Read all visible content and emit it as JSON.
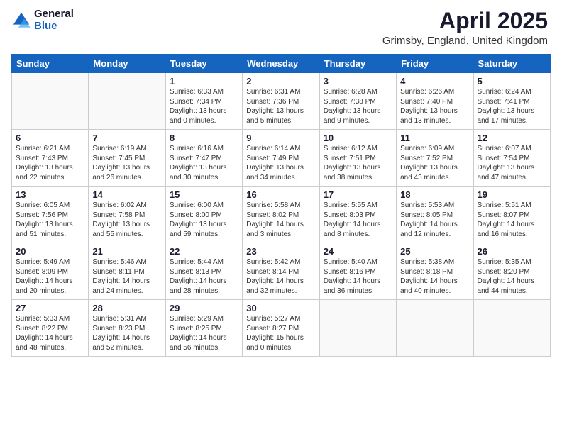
{
  "header": {
    "logo_general": "General",
    "logo_blue": "Blue",
    "month": "April 2025",
    "location": "Grimsby, England, United Kingdom"
  },
  "weekdays": [
    "Sunday",
    "Monday",
    "Tuesday",
    "Wednesday",
    "Thursday",
    "Friday",
    "Saturday"
  ],
  "weeks": [
    [
      {
        "day": "",
        "info": ""
      },
      {
        "day": "",
        "info": ""
      },
      {
        "day": "1",
        "info": "Sunrise: 6:33 AM\nSunset: 7:34 PM\nDaylight: 13 hours and 0 minutes."
      },
      {
        "day": "2",
        "info": "Sunrise: 6:31 AM\nSunset: 7:36 PM\nDaylight: 13 hours and 5 minutes."
      },
      {
        "day": "3",
        "info": "Sunrise: 6:28 AM\nSunset: 7:38 PM\nDaylight: 13 hours and 9 minutes."
      },
      {
        "day": "4",
        "info": "Sunrise: 6:26 AM\nSunset: 7:40 PM\nDaylight: 13 hours and 13 minutes."
      },
      {
        "day": "5",
        "info": "Sunrise: 6:24 AM\nSunset: 7:41 PM\nDaylight: 13 hours and 17 minutes."
      }
    ],
    [
      {
        "day": "6",
        "info": "Sunrise: 6:21 AM\nSunset: 7:43 PM\nDaylight: 13 hours and 22 minutes."
      },
      {
        "day": "7",
        "info": "Sunrise: 6:19 AM\nSunset: 7:45 PM\nDaylight: 13 hours and 26 minutes."
      },
      {
        "day": "8",
        "info": "Sunrise: 6:16 AM\nSunset: 7:47 PM\nDaylight: 13 hours and 30 minutes."
      },
      {
        "day": "9",
        "info": "Sunrise: 6:14 AM\nSunset: 7:49 PM\nDaylight: 13 hours and 34 minutes."
      },
      {
        "day": "10",
        "info": "Sunrise: 6:12 AM\nSunset: 7:51 PM\nDaylight: 13 hours and 38 minutes."
      },
      {
        "day": "11",
        "info": "Sunrise: 6:09 AM\nSunset: 7:52 PM\nDaylight: 13 hours and 43 minutes."
      },
      {
        "day": "12",
        "info": "Sunrise: 6:07 AM\nSunset: 7:54 PM\nDaylight: 13 hours and 47 minutes."
      }
    ],
    [
      {
        "day": "13",
        "info": "Sunrise: 6:05 AM\nSunset: 7:56 PM\nDaylight: 13 hours and 51 minutes."
      },
      {
        "day": "14",
        "info": "Sunrise: 6:02 AM\nSunset: 7:58 PM\nDaylight: 13 hours and 55 minutes."
      },
      {
        "day": "15",
        "info": "Sunrise: 6:00 AM\nSunset: 8:00 PM\nDaylight: 13 hours and 59 minutes."
      },
      {
        "day": "16",
        "info": "Sunrise: 5:58 AM\nSunset: 8:02 PM\nDaylight: 14 hours and 3 minutes."
      },
      {
        "day": "17",
        "info": "Sunrise: 5:55 AM\nSunset: 8:03 PM\nDaylight: 14 hours and 8 minutes."
      },
      {
        "day": "18",
        "info": "Sunrise: 5:53 AM\nSunset: 8:05 PM\nDaylight: 14 hours and 12 minutes."
      },
      {
        "day": "19",
        "info": "Sunrise: 5:51 AM\nSunset: 8:07 PM\nDaylight: 14 hours and 16 minutes."
      }
    ],
    [
      {
        "day": "20",
        "info": "Sunrise: 5:49 AM\nSunset: 8:09 PM\nDaylight: 14 hours and 20 minutes."
      },
      {
        "day": "21",
        "info": "Sunrise: 5:46 AM\nSunset: 8:11 PM\nDaylight: 14 hours and 24 minutes."
      },
      {
        "day": "22",
        "info": "Sunrise: 5:44 AM\nSunset: 8:13 PM\nDaylight: 14 hours and 28 minutes."
      },
      {
        "day": "23",
        "info": "Sunrise: 5:42 AM\nSunset: 8:14 PM\nDaylight: 14 hours and 32 minutes."
      },
      {
        "day": "24",
        "info": "Sunrise: 5:40 AM\nSunset: 8:16 PM\nDaylight: 14 hours and 36 minutes."
      },
      {
        "day": "25",
        "info": "Sunrise: 5:38 AM\nSunset: 8:18 PM\nDaylight: 14 hours and 40 minutes."
      },
      {
        "day": "26",
        "info": "Sunrise: 5:35 AM\nSunset: 8:20 PM\nDaylight: 14 hours and 44 minutes."
      }
    ],
    [
      {
        "day": "27",
        "info": "Sunrise: 5:33 AM\nSunset: 8:22 PM\nDaylight: 14 hours and 48 minutes."
      },
      {
        "day": "28",
        "info": "Sunrise: 5:31 AM\nSunset: 8:23 PM\nDaylight: 14 hours and 52 minutes."
      },
      {
        "day": "29",
        "info": "Sunrise: 5:29 AM\nSunset: 8:25 PM\nDaylight: 14 hours and 56 minutes."
      },
      {
        "day": "30",
        "info": "Sunrise: 5:27 AM\nSunset: 8:27 PM\nDaylight: 15 hours and 0 minutes."
      },
      {
        "day": "",
        "info": ""
      },
      {
        "day": "",
        "info": ""
      },
      {
        "day": "",
        "info": ""
      }
    ]
  ]
}
